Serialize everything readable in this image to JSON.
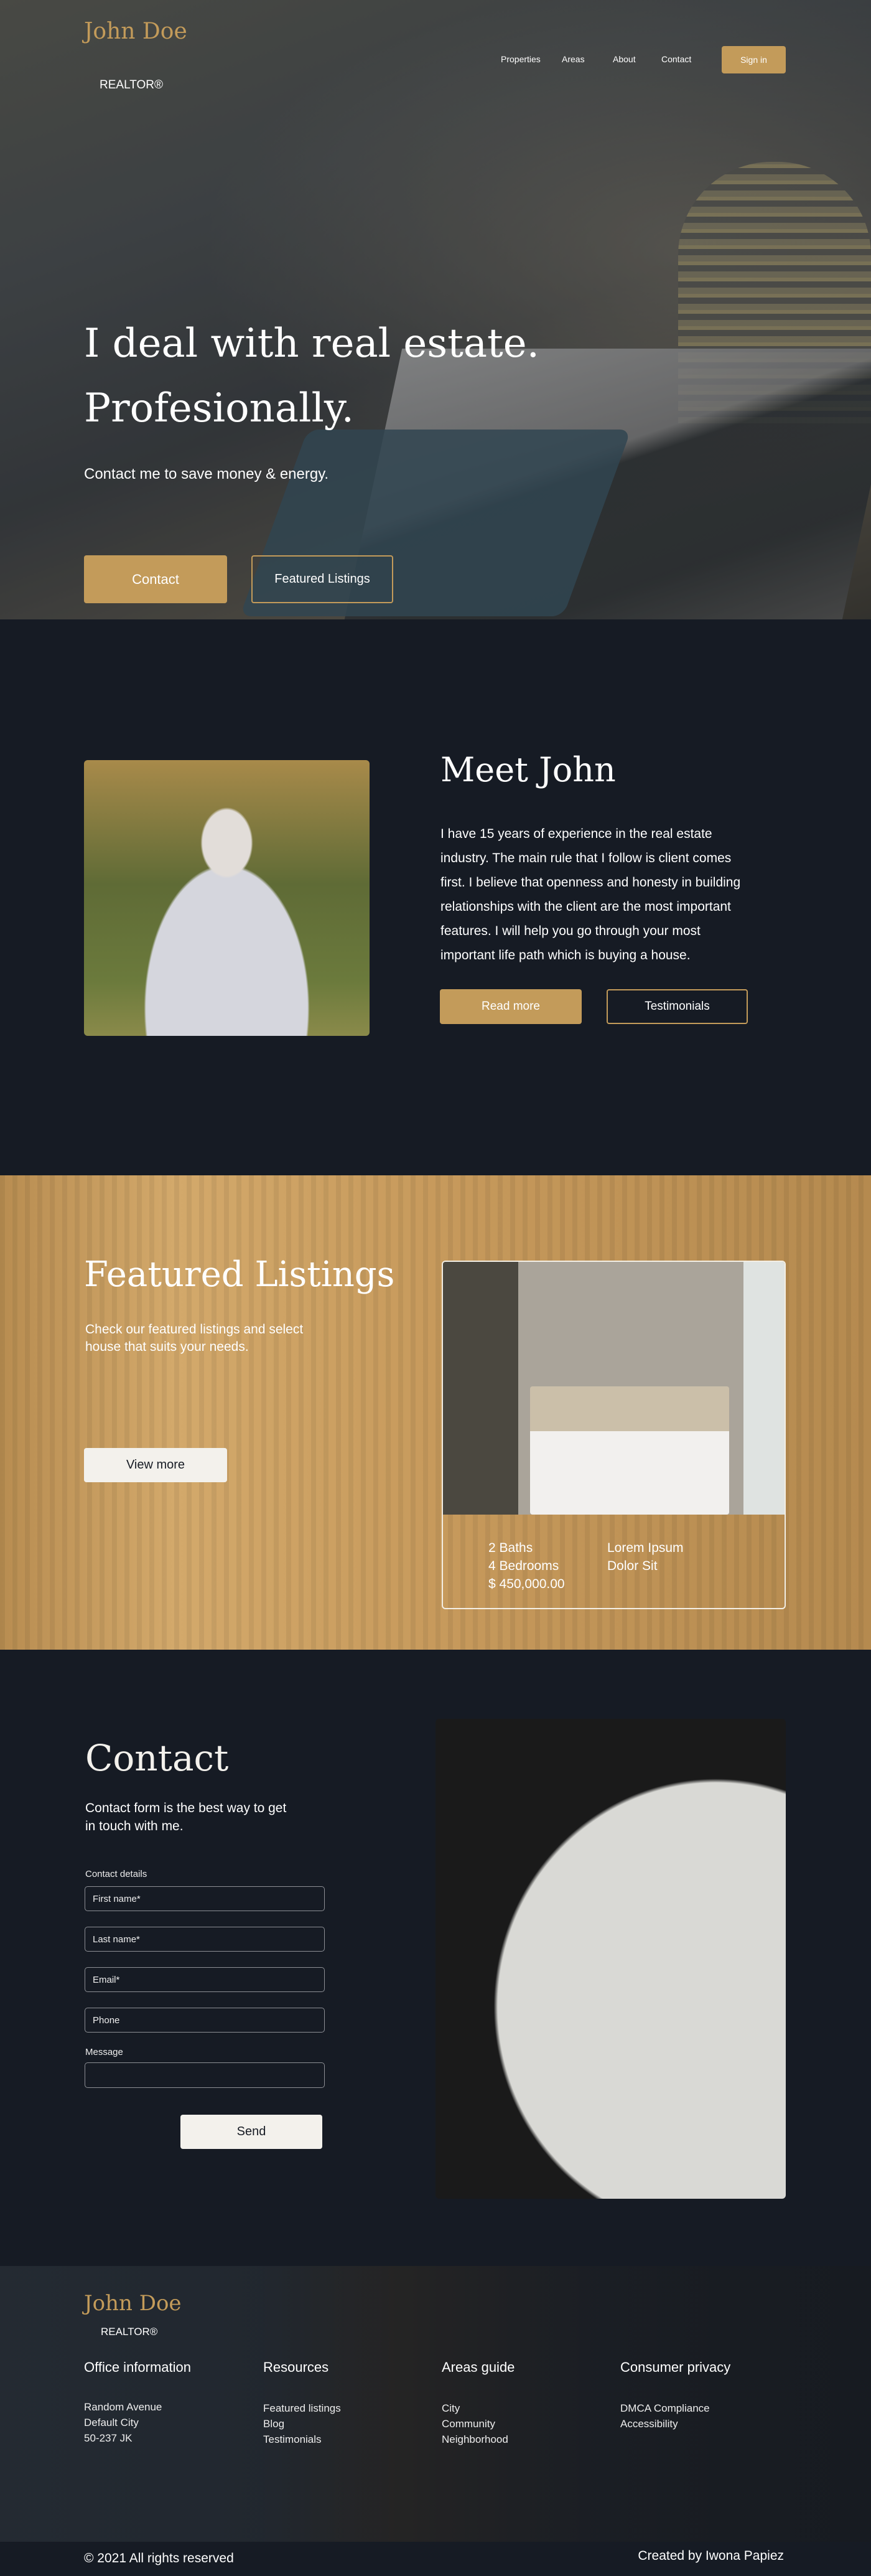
{
  "header": {
    "logo": "John Doe",
    "tagline": "REALTOR®",
    "nav": [
      "Properties",
      "Areas",
      "About",
      "Contact"
    ],
    "sign_in": "Sign in"
  },
  "hero": {
    "title_line1": "I deal with real estate.",
    "title_line2": "Profesionally.",
    "subtitle": "Contact me to save money & energy.",
    "contact_btn": "Contact",
    "featured_btn": "Featured Listings"
  },
  "about": {
    "title": "Meet John",
    "lines": [
      "I have 15 years of experience in the real estate",
      "industry. The main rule that I follow is client comes",
      "first. I believe that openness and honesty in building",
      "relationships with the client are the most important",
      "features. I will help you go through your most",
      "important life path which is buying a house."
    ],
    "read_more": "Read more",
    "testimonials": "Testimonials"
  },
  "featured": {
    "title": "Featured Listings",
    "subtitle_line1": "Check our featured listings and select",
    "subtitle_line2": "house that suits your needs.",
    "view_more": "View more",
    "card": {
      "baths": "2 Baths",
      "bedrooms": "4 Bedrooms",
      "price": "$ 450,000.00",
      "extra1": "Lorem Ipsum",
      "extra2": "Dolor Sit"
    }
  },
  "contact": {
    "title": "Contact",
    "subtitle_line1": "Contact form is the best way to get",
    "subtitle_line2": "in touch with me.",
    "details_label": "Contact details",
    "first_name": "First name*",
    "last_name": "Last name*",
    "email": "Email*",
    "phone": "Phone",
    "message_label": "Message",
    "send": "Send"
  },
  "footer": {
    "logo": "John Doe",
    "tagline": "REALTOR®",
    "columns": [
      {
        "title": "Office information",
        "items": [
          "Random Avenue",
          "Default City",
          "50-237 JK"
        ]
      },
      {
        "title": "Resources",
        "items": [
          "Featured listings",
          "Blog",
          "Testimonials"
        ]
      },
      {
        "title": "Areas guide",
        "items": [
          "City",
          "Community",
          "Neighborhood"
        ]
      },
      {
        "title": "Consumer privacy",
        "items": [
          "DMCA Compliance",
          "Accessibility"
        ]
      }
    ],
    "copyright": "© 2021 All rights reserved",
    "credit": "Created by Iwona Papiez"
  },
  "colors": {
    "accent": "#c39b5a",
    "background": "#161b24",
    "light": "#f3f1ec"
  }
}
